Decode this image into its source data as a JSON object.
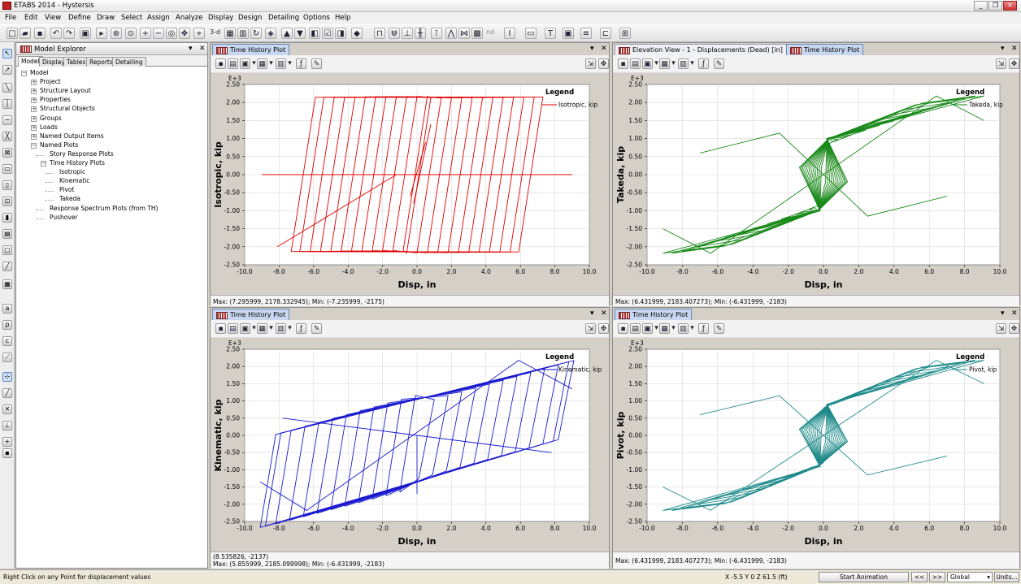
{
  "window": {
    "title": "ETABS 2014 - Hystersis",
    "controls": [
      "_",
      "❐",
      "✕"
    ]
  },
  "menu": [
    "File",
    "Edit",
    "View",
    "Define",
    "Draw",
    "Select",
    "Assign",
    "Analyze",
    "Display",
    "Design",
    "Detailing",
    "Options",
    "Help"
  ],
  "toolbar": {
    "threed": "3-d",
    "plan": "Plan",
    "elev": "Elev",
    "nd": "nd"
  },
  "explorer": {
    "title": "Model Explorer",
    "tabs": [
      "Model",
      "Display",
      "Tables",
      "Reports",
      "Detailing"
    ],
    "tree": [
      {
        "label": "Model",
        "level": 0,
        "exp": "-"
      },
      {
        "label": "Project",
        "level": 1,
        "exp": "+"
      },
      {
        "label": "Structure Layout",
        "level": 1,
        "exp": "+"
      },
      {
        "label": "Properties",
        "level": 1,
        "exp": "+"
      },
      {
        "label": "Structural Objects",
        "level": 1,
        "exp": "+"
      },
      {
        "label": "Groups",
        "level": 1,
        "exp": "+"
      },
      {
        "label": "Loads",
        "level": 1,
        "exp": "+"
      },
      {
        "label": "Named Output Items",
        "level": 1,
        "exp": "+"
      },
      {
        "label": "Named Plots",
        "level": 1,
        "exp": "-"
      },
      {
        "label": "Story Response Plots",
        "level": 2,
        "exp": ""
      },
      {
        "label": "Time History Plots",
        "level": 2,
        "exp": "-"
      },
      {
        "label": "Isotropic",
        "level": 3,
        "exp": ""
      },
      {
        "label": "Kinematic",
        "level": 3,
        "exp": ""
      },
      {
        "label": "Pivot",
        "level": 3,
        "exp": ""
      },
      {
        "label": "Takeda",
        "level": 3,
        "exp": ""
      },
      {
        "label": "Response Spectrum Plots (from TH)",
        "level": 2,
        "exp": ""
      },
      {
        "label": "Pushover",
        "level": 2,
        "exp": ""
      }
    ]
  },
  "panels": [
    {
      "tabs": [
        {
          "label": "Time History Plot",
          "active": true
        }
      ],
      "status": [
        "",
        "Max: (7.295999, 2178.332945);  Min: (-7.235999, -2175)"
      ]
    },
    {
      "tabs": [
        {
          "label": "Elevation View - 1  - Displacements (Dead)  [in]",
          "active": false
        },
        {
          "label": "Time History Plot",
          "active": true
        }
      ],
      "status": [
        "",
        "Max: (6.431999, 2183.407273);  Min: (-6.431999, -2183)"
      ]
    },
    {
      "tabs": [
        {
          "label": "Time History Plot",
          "active": true
        }
      ],
      "status": [
        "(8.535826, -2137)",
        "Max: (5.855999, 2185.099998);  Min: (-6.431999, -2183)"
      ]
    },
    {
      "tabs": [
        {
          "label": "Time History Plot",
          "active": true
        }
      ],
      "status": [
        "",
        "Max: (6.431999, 2183.407273);  Min: (-6.431999, -2183)"
      ]
    }
  ],
  "chart_data": [
    {
      "type": "line",
      "model": "isotropic",
      "color": "#e00000",
      "xlabel": "Disp,  in",
      "ylabel": "Isotropic,  kip",
      "exponent": "E+3",
      "legend_title": "Legend",
      "xlim": [
        -10,
        10
      ],
      "ylim": [
        -2.5,
        2.5
      ],
      "xticks": [
        "-10.0",
        "-8.0",
        "-6.0",
        "-4.0",
        "-2.0",
        "0.0",
        "2.0",
        "4.0",
        "6.0",
        "8.0",
        "10.0"
      ],
      "yticks": [
        "-2.50",
        "-2.00",
        "-1.50",
        "-1.00",
        "-0.50",
        "0.00",
        "0.50",
        "1.00",
        "1.50",
        "2.00",
        "2.50"
      ],
      "grid": true,
      "legend_position": "top-right",
      "series": [
        {
          "name": "Isotropic, kip",
          "amps": [
            0.8,
            1.4,
            2.0,
            2.6,
            3.2,
            3.8,
            4.4,
            5.0,
            5.6,
            6.2,
            6.8,
            7.3
          ]
        }
      ]
    },
    {
      "type": "line",
      "model": "takeda",
      "color": "#1a8a1a",
      "xlabel": "Disp,  in",
      "ylabel": "Takeda,  kip",
      "exponent": "E+3",
      "legend_title": "Legend",
      "xlim": [
        -10,
        10
      ],
      "ylim": [
        -2.5,
        2.5
      ],
      "xticks": [
        "-10.0",
        "-8.0",
        "-6.0",
        "-4.0",
        "-2.0",
        "0.0",
        "2.0",
        "4.0",
        "6.0",
        "8.0",
        "10.0"
      ],
      "yticks": [
        "-2.50",
        "-2.00",
        "-1.50",
        "-1.00",
        "-0.50",
        "0.00",
        "0.50",
        "1.00",
        "1.50",
        "2.00",
        "2.50"
      ],
      "grid": true,
      "legend_position": "top-right",
      "series": [
        {
          "name": "Takeda, kip",
          "amps": [
            0.8,
            1.6,
            2.4,
            3.2,
            4.0,
            4.8,
            5.6,
            6.4,
            7.2,
            8.0,
            8.6,
            9.1
          ]
        }
      ]
    },
    {
      "type": "line",
      "model": "kinematic",
      "color": "#1a1ad0",
      "xlabel": "Disp,  in",
      "ylabel": "Kinematic,  kip",
      "exponent": "E+3",
      "legend_title": "Legend",
      "xlim": [
        -10,
        10
      ],
      "ylim": [
        -2.5,
        2.5
      ],
      "xticks": [
        "-10.0",
        "-8.0",
        "-6.0",
        "-4.0",
        "-2.0",
        "0.0",
        "2.0",
        "4.0",
        "6.0",
        "8.0",
        "10.0"
      ],
      "yticks": [
        "-2.50",
        "-2.00",
        "-1.50",
        "-1.00",
        "-0.50",
        "0.00",
        "0.50",
        "1.00",
        "1.50",
        "2.00",
        "2.50"
      ],
      "grid": true,
      "legend_position": "top-right",
      "series": [
        {
          "name": "Kinematic, kip",
          "amps": [
            1.0,
            1.8,
            2.6,
            3.4,
            4.2,
            5.0,
            5.8,
            6.6,
            7.4,
            8.2,
            8.8,
            9.1
          ]
        }
      ]
    },
    {
      "type": "line",
      "model": "pivot",
      "color": "#1f8a8a",
      "xlabel": "Disp,  in",
      "ylabel": "Pivot,  kip",
      "exponent": "E+3",
      "legend_title": "Legend",
      "xlim": [
        -10,
        10
      ],
      "ylim": [
        -2.5,
        2.5
      ],
      "xticks": [
        "-10.0",
        "-8.0",
        "-6.0",
        "-4.0",
        "-2.0",
        "0.0",
        "2.0",
        "4.0",
        "6.0",
        "8.0",
        "10.0"
      ],
      "yticks": [
        "-2.50",
        "-2.00",
        "-1.50",
        "-1.00",
        "-0.50",
        "0.00",
        "0.50",
        "1.00",
        "1.50",
        "2.00",
        "2.50"
      ],
      "grid": true,
      "legend_position": "top-right",
      "series": [
        {
          "name": "Pivot, kip",
          "amps": [
            0.8,
            1.6,
            2.4,
            3.2,
            4.0,
            4.8,
            5.6,
            6.4,
            7.2,
            8.0,
            8.6,
            9.1
          ]
        }
      ]
    }
  ],
  "statusbar": {
    "hint": "Right Click on any Point for displacement values",
    "coords": "X -5.5  Y 0  Z 61.5  (ft)",
    "animation": "Start Animation",
    "prev": "<<",
    "next": ">>",
    "coord_system": "Global",
    "units": "Units..."
  }
}
